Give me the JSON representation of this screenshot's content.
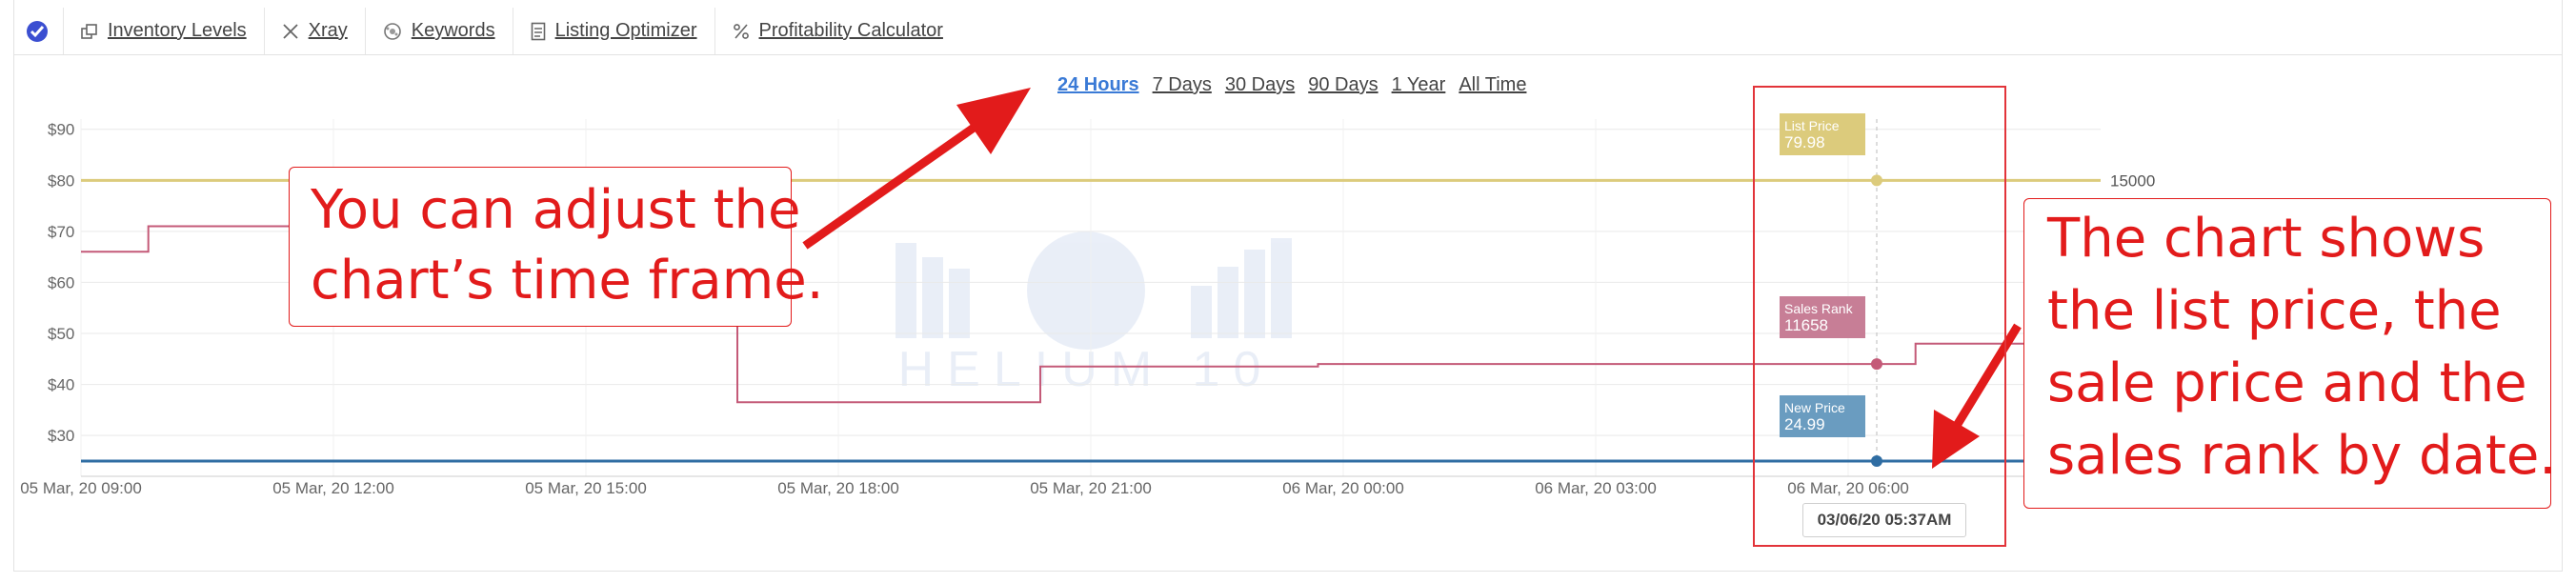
{
  "toolbar": {
    "items": [
      {
        "label": "Inventory Levels",
        "icon": "inventory-icon"
      },
      {
        "label": "Xray",
        "icon": "close-x-icon"
      },
      {
        "label": "Keywords",
        "icon": "keywords-icon"
      },
      {
        "label": "Listing Optimizer",
        "icon": "document-icon"
      },
      {
        "label": "Profitability Calculator",
        "icon": "percent-icon"
      }
    ]
  },
  "timeframes": {
    "options": [
      "24 Hours",
      "7 Days",
      "30 Days",
      "90 Days",
      "1 Year",
      "All Time"
    ],
    "selected": "24 Hours"
  },
  "chart_data": {
    "type": "line",
    "y_ticks": [
      "$90",
      "$80",
      "$70",
      "$60",
      "$50",
      "$40",
      "$30"
    ],
    "x_ticks": [
      "05 Mar, 20 09:00",
      "05 Mar, 20 12:00",
      "05 Mar, 20 15:00",
      "05 Mar, 20 18:00",
      "05 Mar, 20 21:00",
      "06 Mar, 20 00:00",
      "06 Mar, 20 03:00",
      "06 Mar, 20 06:00"
    ],
    "right_axis_label": "15000",
    "ylim": [
      22,
      92
    ],
    "xlim": [
      0,
      24
    ],
    "colors": {
      "list_price": "#dccb7c",
      "sales_rank": "#c45a78",
      "new_price": "#2f6da3"
    },
    "series": [
      {
        "key": "list_price",
        "points": [
          [
            0,
            79.98
          ],
          [
            24,
            79.98
          ]
        ]
      },
      {
        "key": "new_price",
        "points": [
          [
            0,
            24.99
          ],
          [
            24,
            24.99
          ]
        ]
      },
      {
        "key": "sales_rank",
        "points": [
          [
            0,
            66
          ],
          [
            0.8,
            66
          ],
          [
            0.8,
            71
          ],
          [
            3,
            71
          ],
          [
            3,
            72
          ],
          [
            7.8,
            72
          ],
          [
            7.8,
            36.5
          ],
          [
            11.4,
            36.5
          ],
          [
            11.4,
            43.5
          ],
          [
            14.7,
            43.5
          ],
          [
            14.7,
            44
          ],
          [
            21.8,
            44
          ],
          [
            21.8,
            48
          ],
          [
            24,
            48
          ]
        ]
      }
    ],
    "tooltips": {
      "list_price": {
        "label": "List Price",
        "value": "79.98"
      },
      "sales_rank": {
        "label": "Sales Rank",
        "value": "11658"
      },
      "new_price": {
        "label": "New Price",
        "value": "24.99"
      },
      "date": "03/06/20 05:37AM"
    }
  },
  "callouts": {
    "left": [
      "You can adjust the",
      "chart’s time frame."
    ],
    "right": [
      "The chart shows",
      "the list price, the",
      "sale price and the",
      "sales rank by date."
    ]
  },
  "watermark": "HELIUM 10"
}
